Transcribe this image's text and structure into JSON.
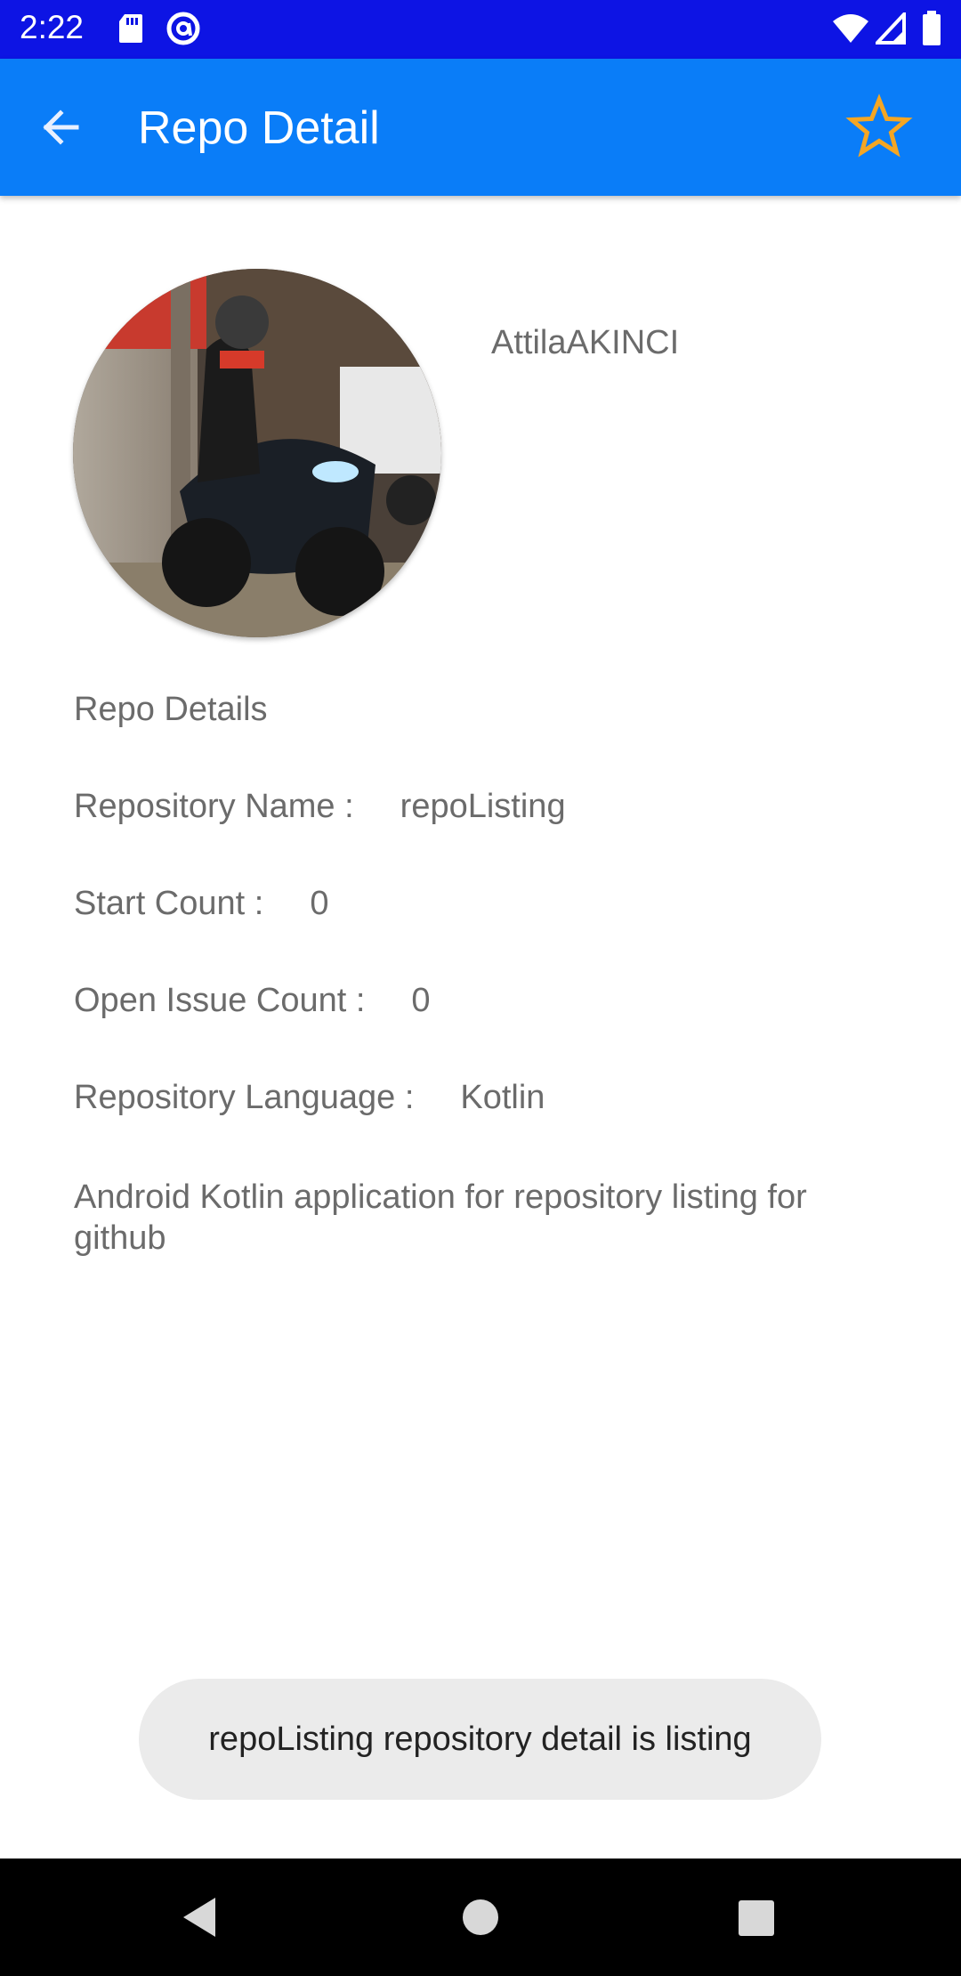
{
  "status_bar": {
    "time": "2:22",
    "icons": [
      "sd-card-icon",
      "at-sign-icon",
      "wifi-icon",
      "signal-icon",
      "battery-icon"
    ]
  },
  "app_bar": {
    "title": "Repo Detail",
    "back_icon": "arrow-back-icon",
    "favorite_icon": "star-outline-icon",
    "colors": {
      "background": "#0a7df8",
      "star": "#f5a623",
      "status_bar": "#0d14e4"
    }
  },
  "owner": {
    "login": "AttilaAKINCI",
    "avatar": "motorcycle-rider-photo"
  },
  "details": {
    "section_title": "Repo Details",
    "repository_name_label": "Repository Name :",
    "repository_name": "repoListing",
    "star_count_label": "Start Count :",
    "star_count": "0",
    "open_issue_label": "Open Issue Count :",
    "open_issue_count": "0",
    "language_label": "Repository Language :",
    "language": "Kotlin",
    "description": "Android Kotlin application for repository listing for github"
  },
  "toast": {
    "message": "repoListing repository detail is listing"
  },
  "nav_bar": {
    "icons": [
      "nav-back-icon",
      "nav-home-icon",
      "nav-recents-icon"
    ]
  }
}
